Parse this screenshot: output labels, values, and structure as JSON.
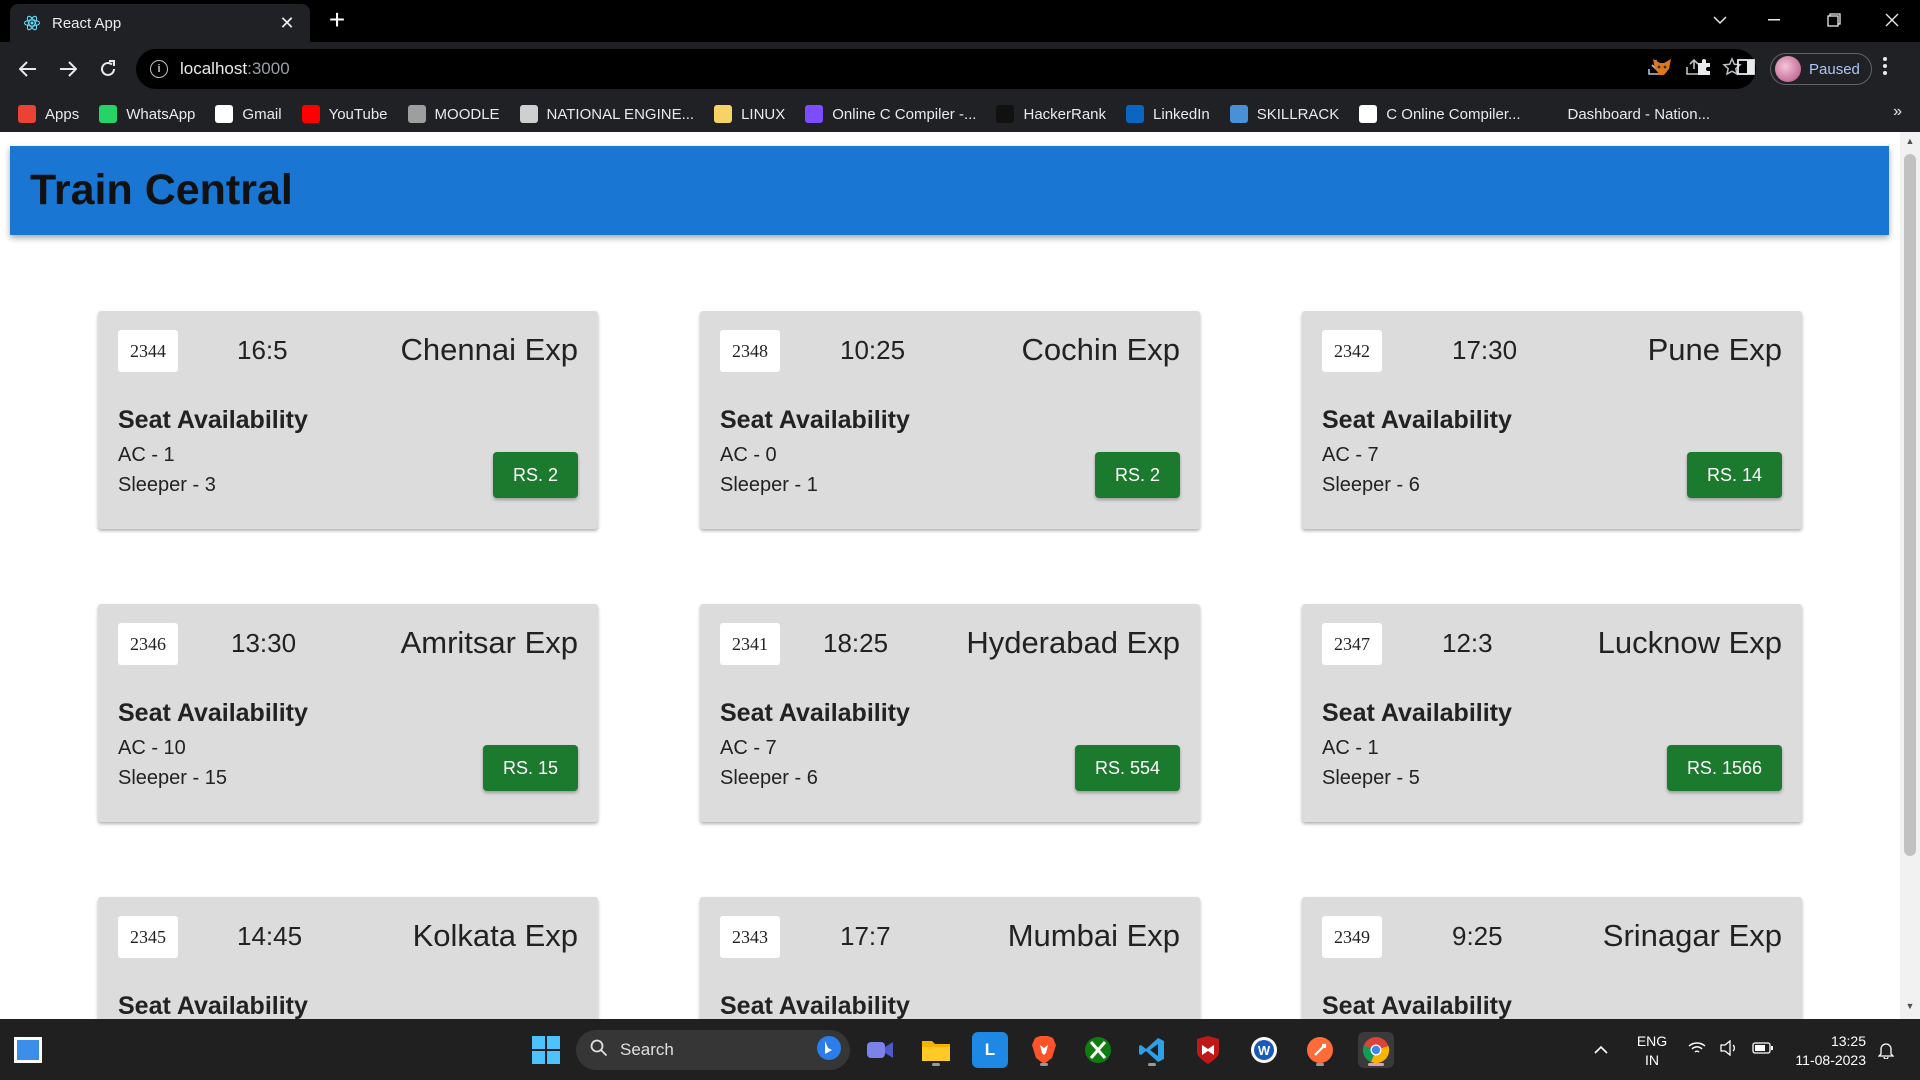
{
  "browser": {
    "tab_title": "React App",
    "close_glyph": "✕",
    "newtab_glyph": "+",
    "url_host": "localhost",
    "url_port": ":3000",
    "profile_status": "Paused",
    "bookmarks": [
      {
        "label": "Apps",
        "icon": "apps-grid-icon",
        "color": "#ea4335"
      },
      {
        "label": "WhatsApp",
        "icon": "whatsapp-icon",
        "color": "#25d366"
      },
      {
        "label": "Gmail",
        "icon": "google-icon",
        "color": "#ffffff"
      },
      {
        "label": "YouTube",
        "icon": "youtube-icon",
        "color": "#ff0000"
      },
      {
        "label": "MOODLE",
        "icon": "moodle-icon",
        "color": "#9e9e9e"
      },
      {
        "label": "NATIONAL ENGINE...",
        "icon": "nptel-icon",
        "color": "#cfcfcf"
      },
      {
        "label": "LINUX",
        "icon": "folder-icon",
        "color": "#f6d365"
      },
      {
        "label": "Online C Compiler -...",
        "icon": "compiler-icon",
        "color": "#7c4dff"
      },
      {
        "label": "HackerRank",
        "icon": "hackerrank-icon",
        "color": "#111111"
      },
      {
        "label": "LinkedIn",
        "icon": "linkedin-icon",
        "color": "#0a66c2"
      },
      {
        "label": "SKILLRACK",
        "icon": "skillrack-icon",
        "color": "#4a90d9"
      },
      {
        "label": "C Online Compiler...",
        "icon": "online-compiler-icon",
        "color": "#ffffff"
      },
      {
        "label": "Dashboard - Nation...",
        "icon": "dashboard-icon",
        "color": "#202124"
      }
    ],
    "bookmarks_overflow": "»"
  },
  "app": {
    "title": "Train Central",
    "seat_heading": "Seat Availability",
    "trains": [
      {
        "number": "2344",
        "time": "16:5",
        "name": "Chennai Exp",
        "ac": "AC - 1",
        "sleeper": "Sleeper - 3",
        "price": "RS. 2"
      },
      {
        "number": "2348",
        "time": "10:25",
        "name": "Cochin Exp",
        "ac": "AC - 0",
        "sleeper": "Sleeper - 1",
        "price": "RS. 2"
      },
      {
        "number": "2342",
        "time": "17:30",
        "name": "Pune Exp",
        "ac": "AC - 7",
        "sleeper": "Sleeper - 6",
        "price": "RS. 14"
      },
      {
        "number": "2346",
        "time": "13:30",
        "name": "Amritsar Exp",
        "ac": "AC - 10",
        "sleeper": "Sleeper - 15",
        "price": "RS. 15"
      },
      {
        "number": "2341",
        "time": "18:25",
        "name": "Hyderabad Exp",
        "ac": "AC - 7",
        "sleeper": "Sleeper - 6",
        "price": "RS. 554"
      },
      {
        "number": "2347",
        "time": "12:3",
        "name": "Lucknow Exp",
        "ac": "AC - 1",
        "sleeper": "Sleeper - 5",
        "price": "RS. 1566"
      },
      {
        "number": "2345",
        "time": "14:45",
        "name": "Kolkata Exp",
        "ac": "",
        "sleeper": "",
        "price": ""
      },
      {
        "number": "2343",
        "time": "17:7",
        "name": "Mumbai Exp",
        "ac": "",
        "sleeper": "",
        "price": ""
      },
      {
        "number": "2349",
        "time": "9:25",
        "name": "Srinagar Exp",
        "ac": "",
        "sleeper": "",
        "price": ""
      }
    ],
    "header_color": "#1976d2",
    "button_color": "#1b7a2d"
  },
  "taskbar": {
    "search_label": "Search",
    "language_line1": "ENG",
    "language_line2": "IN",
    "time": "13:25",
    "date": "11-08-2023",
    "apps": [
      {
        "name": "windows-start-icon"
      },
      {
        "name": "meet-icon"
      },
      {
        "name": "file-explorer-icon"
      },
      {
        "name": "l-app-icon",
        "letter": "L"
      },
      {
        "name": "brave-icon"
      },
      {
        "name": "xbox-icon"
      },
      {
        "name": "vscode-icon"
      },
      {
        "name": "mcafee-icon"
      },
      {
        "name": "word-icon"
      },
      {
        "name": "postman-icon"
      },
      {
        "name": "chrome-icon"
      }
    ]
  }
}
